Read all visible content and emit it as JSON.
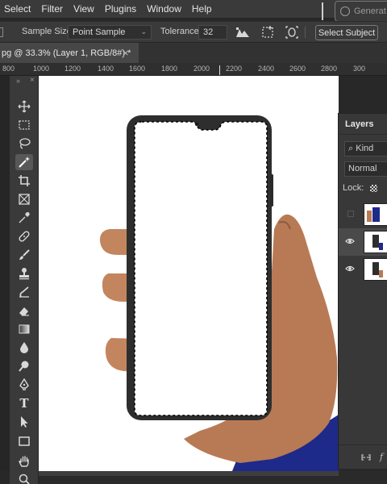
{
  "menu": [
    "Select",
    "Filter",
    "View",
    "Plugins",
    "Window",
    "Help"
  ],
  "generate_button": "Generat",
  "options": {
    "sample_size_label": "Sample Size:",
    "sample_size_value": "Point Sample",
    "tolerance_label": "Tolerance:",
    "tolerance_value": "32",
    "select_subject": "Select Subject"
  },
  "document_tab": {
    "title": "pg @ 33.3% (Layer 1, RGB/8#) *",
    "close": "×"
  },
  "ruler": {
    "labels": [
      "800",
      "1000",
      "1200",
      "1400",
      "1600",
      "1800",
      "2000",
      "2200",
      "2400",
      "2600",
      "2800",
      "300"
    ]
  },
  "toolbar": {
    "expand": "»",
    "close": "×"
  },
  "tools": [
    {
      "name": "move-tool",
      "icon": "move-icon"
    },
    {
      "name": "marquee-tool",
      "icon": "marquee-icon"
    },
    {
      "name": "lasso-tool",
      "icon": "lasso-icon"
    },
    {
      "name": "magic-wand-tool",
      "icon": "magic-wand-icon",
      "active": true
    },
    {
      "name": "crop-tool",
      "icon": "crop-icon"
    },
    {
      "name": "frame-tool",
      "icon": "frame-icon"
    },
    {
      "name": "eyedropper-tool",
      "icon": "eyedropper-icon"
    },
    {
      "name": "healing-brush-tool",
      "icon": "bandage-icon"
    },
    {
      "name": "brush-tool",
      "icon": "brush-icon"
    },
    {
      "name": "clone-stamp-tool",
      "icon": "stamp-icon"
    },
    {
      "name": "history-brush-tool",
      "icon": "history-brush-icon"
    },
    {
      "name": "eraser-tool",
      "icon": "eraser-icon"
    },
    {
      "name": "gradient-tool",
      "icon": "gradient-icon"
    },
    {
      "name": "blur-tool",
      "icon": "drop-icon"
    },
    {
      "name": "dodge-tool",
      "icon": "dodge-icon"
    },
    {
      "name": "pen-tool",
      "icon": "pen-icon"
    },
    {
      "name": "type-tool",
      "icon": "type-icon"
    },
    {
      "name": "path-selection-tool",
      "icon": "arrow-icon"
    },
    {
      "name": "rectangle-tool",
      "icon": "rectangle-icon"
    },
    {
      "name": "hand-tool",
      "icon": "hand-icon"
    },
    {
      "name": "zoom-tool",
      "icon": "zoom-icon"
    }
  ],
  "type_tool_glyph": "T",
  "layers_panel": {
    "title": "Layers",
    "kind": "Kind",
    "blend_mode": "Normal",
    "lock_label": "Lock:"
  },
  "colors": {
    "accent_blue": "#1e2a8a",
    "panel": "#383838",
    "ui": "#3a3a3a"
  }
}
